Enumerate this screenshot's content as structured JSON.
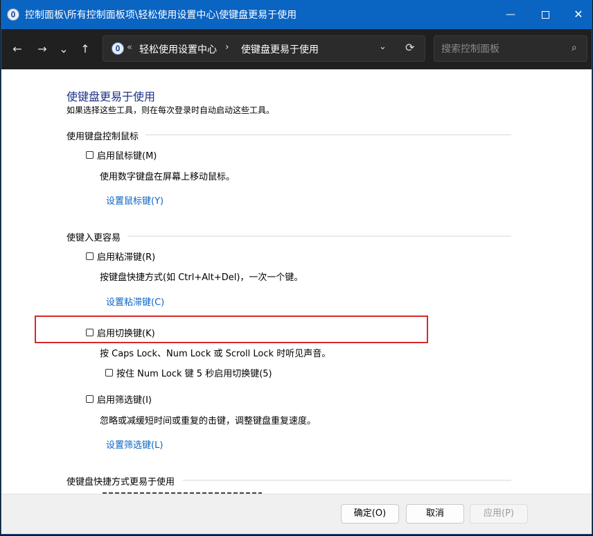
{
  "window": {
    "title": "控制面板\\所有控制面板项\\轻松使用设置中心\\使键盘更易于使用",
    "minimize_glyph": "—",
    "close_glyph": "✕"
  },
  "nav": {
    "back_glyph": "←",
    "forward_glyph": "→",
    "recent_glyph": "⌄",
    "up_glyph": "↑",
    "overflow_glyph": "«",
    "breadcrumb_1": "轻松使用设置中心",
    "breadcrumb_separator": "›",
    "breadcrumb_2": "使键盘更易于使用",
    "dropdown_glyph": "⌄",
    "refresh_glyph": "⟳",
    "search_placeholder": "搜索控制面板",
    "search_glyph": "⌕"
  },
  "page": {
    "title": "使键盘更易于使用",
    "subtitle": "如果选择这些工具，则在每次登录时自动启动这些工具。"
  },
  "section_mouse": {
    "heading": "使用键盘控制鼠标",
    "mouse_keys_label": "启用鼠标键(M)",
    "mouse_keys_desc": "使用数字键盘在屏幕上移动鼠标。",
    "mouse_keys_link": "设置鼠标键(Y)"
  },
  "section_typing": {
    "heading": "使键入更容易",
    "sticky_keys_label": "启用粘滞键(R)",
    "sticky_keys_desc": "按键盘快捷方式(如 Ctrl+Alt+Del)，一次一个键。",
    "sticky_keys_link": "设置粘滞键(C)",
    "toggle_keys_label": "启用切换键(K)",
    "toggle_keys_desc": "按 Caps Lock、Num Lock 或 Scroll Lock 时听见声音。",
    "toggle_keys_hold_label": "按住 Num Lock 键 5 秒启用切换键(5)",
    "filter_keys_label": "启用筛选键(I)",
    "filter_keys_desc": "忽略或减缓短时间或重复的击键，调整键盘重复速度。",
    "filter_keys_link": "设置筛选键(L)"
  },
  "section_shortcuts": {
    "heading": "使键盘快捷方式更易于使用"
  },
  "footer": {
    "ok_label": "确定(O)",
    "cancel_label": "取消",
    "apply_label": "应用(P)"
  },
  "colors": {
    "title_bar": "#0a64c2",
    "nav_bar": "#202020",
    "link": "#0a64c2",
    "page_title": "#1e3287",
    "highlight": "#d6282a"
  }
}
